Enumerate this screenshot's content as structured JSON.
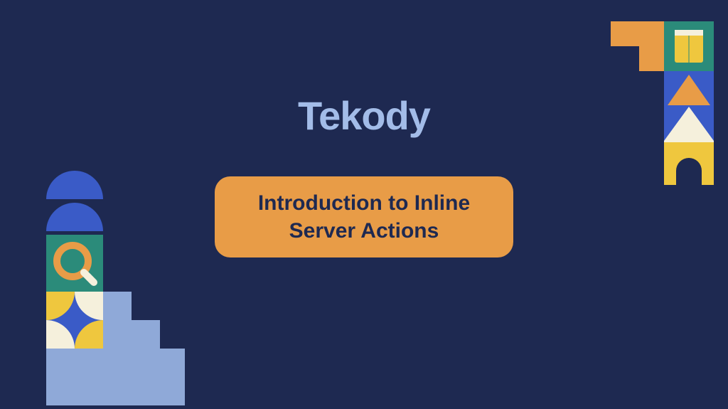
{
  "brand": "Tekody",
  "subtitle": "Introduction to Inline Server Actions",
  "colors": {
    "background": "#1e2951",
    "accent_blue_light": "#a3bce8",
    "accent_orange": "#e89c47",
    "accent_blue": "#3a5bc7",
    "accent_teal": "#2b8b7a",
    "accent_yellow": "#efc73e",
    "accent_cream": "#f5f0dc"
  }
}
